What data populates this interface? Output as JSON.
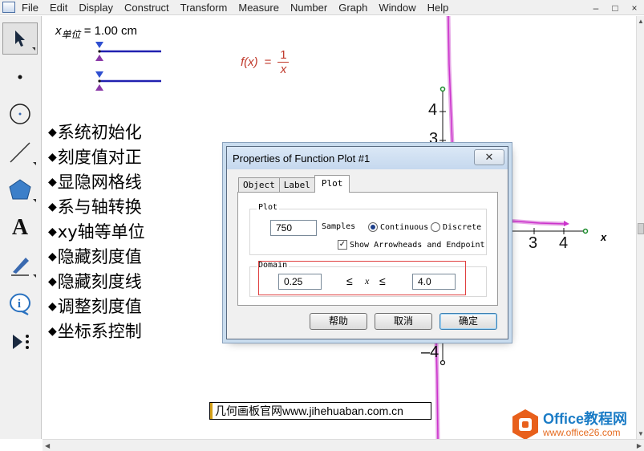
{
  "menubar": {
    "items": [
      "File",
      "Edit",
      "Display",
      "Construct",
      "Transform",
      "Measure",
      "Number",
      "Graph",
      "Window",
      "Help"
    ],
    "controls": [
      "–",
      "□",
      "×"
    ]
  },
  "toolbox": {
    "tools": [
      {
        "name": "arrow-tool-icon",
        "label": ""
      },
      {
        "name": "point-tool-icon",
        "label": ""
      },
      {
        "name": "compass-tool-icon",
        "label": ""
      },
      {
        "name": "straightedge-tool-icon",
        "label": ""
      },
      {
        "name": "polygon-tool-icon",
        "label": ""
      },
      {
        "name": "text-tool-icon",
        "label": "A"
      },
      {
        "name": "marker-tool-icon",
        "label": ""
      },
      {
        "name": "information-tool-icon",
        "label": ""
      },
      {
        "name": "custom-tool-icon",
        "label": ""
      }
    ]
  },
  "canvas": {
    "x_unit": {
      "var": "x",
      "sub": "单位",
      "value": "= 1.00 cm"
    },
    "function": {
      "label": "f(x)",
      "eq": "=",
      "numerator": "1",
      "denominator": "x"
    },
    "action_buttons": [
      "系统初始化",
      "刻度值对正",
      "显隐网格线",
      "系与轴转换",
      "xy轴等单位",
      "隐藏刻度值",
      "隐藏刻度线",
      "调整刻度值",
      "坐标系控制"
    ],
    "bullet": "◆",
    "ticks": {
      "y4": "4",
      "y3": "3",
      "x3": "3",
      "x4": "4",
      "yneg4": "–4"
    },
    "x_axis_label": "x",
    "watermark": "几何画板官网www.jihehuaban.com.cn",
    "logo": {
      "title": "Office教程网",
      "url": "www.office26.com"
    }
  },
  "dialog": {
    "title": "Properties of Function Plot #1",
    "close": "✕",
    "tabs": [
      "Object",
      "Label",
      "Plot"
    ],
    "active_tab": "Plot",
    "plot_group": "Plot",
    "samples_value": "750",
    "samples_label": "Samples",
    "continuous_label": "Continuous",
    "discrete_label": "Discrete",
    "arrowheads_label": "Show Arrowheads and Endpoint",
    "arrowheads_checked": "✓",
    "domain_group": "Domain",
    "domain_min": "0.25",
    "domain_max": "4.0",
    "le1": "≤",
    "x_var": "x",
    "le2": "≤",
    "buttons": {
      "help": "帮助",
      "cancel": "取消",
      "ok": "确定"
    }
  },
  "colors": {
    "plot": "#cc33cc",
    "handle_line": "#2020b0",
    "accent_red": "#c0392b"
  }
}
